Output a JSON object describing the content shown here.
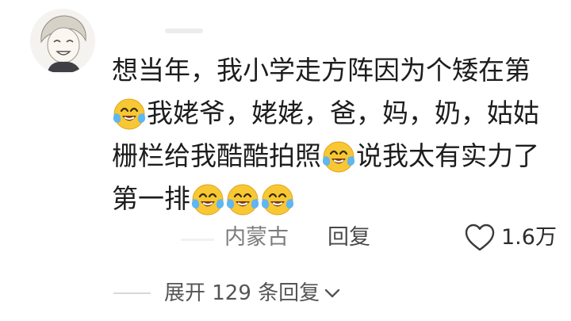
{
  "comment": {
    "lines": [
      {
        "segments": [
          {
            "text": "想当年，我小学走方阵因为个矮在第"
          }
        ]
      },
      {
        "segments": [
          {
            "emoji": "crying-laughing-emoji"
          },
          {
            "text": "我姥爷，姥姥，爸，妈，奶，姑姑"
          }
        ]
      },
      {
        "segments": [
          {
            "text": "栅栏给我酷酷拍照"
          },
          {
            "emoji": "crying-laughing-emoji"
          },
          {
            "text": "说我太有实力了"
          }
        ]
      },
      {
        "segments": [
          {
            "text": "第一排"
          },
          {
            "emoji": "crying-laughing-emoji"
          },
          {
            "emoji": "crying-laughing-emoji"
          },
          {
            "emoji": "crying-laughing-emoji"
          }
        ]
      }
    ]
  },
  "footer": {
    "location": "内蒙古",
    "reply_label": "回复",
    "like_count": "1.6万",
    "like_icon": "heart-outline-icon"
  },
  "expand": {
    "label": "展开 129 条回复",
    "icon": "chevron-down-icon"
  },
  "colors": {
    "text_primary": "#1d1d1d",
    "text_secondary": "#7c7c7c",
    "emoji_yellow": "#f7c833",
    "tear_blue": "#5fb6f0"
  }
}
